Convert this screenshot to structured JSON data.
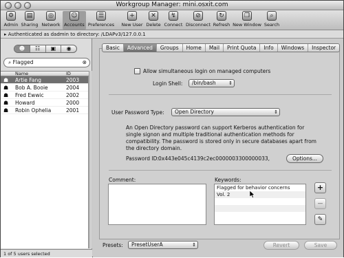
{
  "window": {
    "title": "Workgroup Manager: mini.osxit.com"
  },
  "toolbar": {
    "items": [
      {
        "label": "Admin",
        "icon": "admin-icon",
        "glyph": "⚙"
      },
      {
        "label": "Sharing",
        "icon": "sharing-icon",
        "glyph": "▤"
      },
      {
        "label": "Network",
        "icon": "network-icon",
        "glyph": "◎"
      },
      {
        "label": "Accounts",
        "icon": "accounts-icon",
        "glyph": "☺",
        "selected": true
      },
      {
        "label": "Preferences",
        "icon": "preferences-icon",
        "glyph": "☰"
      },
      {
        "label": "New User",
        "icon": "new-user-icon",
        "glyph": "+"
      },
      {
        "label": "Delete",
        "icon": "delete-icon",
        "glyph": "✕"
      },
      {
        "label": "Connect",
        "icon": "connect-icon",
        "glyph": "↯"
      },
      {
        "label": "Disconnect",
        "icon": "disconnect-icon",
        "glyph": "⊘"
      },
      {
        "label": "Refresh",
        "icon": "refresh-icon",
        "glyph": "↻"
      },
      {
        "label": "New Window",
        "icon": "new-window-icon",
        "glyph": "❐"
      },
      {
        "label": "Search",
        "icon": "search-icon",
        "glyph": "⌕"
      }
    ]
  },
  "auth": {
    "text": "Authenticated as dadmin to directory: /LDAPv3/127.0.0.1"
  },
  "sidebar": {
    "segments": [
      "user-icon",
      "group-icon",
      "computer-group-icon",
      "computer-list-icon"
    ],
    "search_value": "Flagged",
    "columns": {
      "name": "Name",
      "id": "ID"
    },
    "users": [
      {
        "name": "Artie Fang",
        "id": "2003",
        "selected": true
      },
      {
        "name": "Bob A. Booie",
        "id": "2004"
      },
      {
        "name": "Fred Ewwic",
        "id": "2002"
      },
      {
        "name": "Howard",
        "id": "2000"
      },
      {
        "name": "Robin Ophelia",
        "id": "2001"
      }
    ],
    "status": "1 of 5 users selected"
  },
  "tabs": [
    {
      "label": "Basic"
    },
    {
      "label": "Advanced",
      "selected": true
    },
    {
      "label": "Groups"
    },
    {
      "label": "Home"
    },
    {
      "label": "Mail"
    },
    {
      "label": "Print Quota"
    },
    {
      "label": "Info"
    },
    {
      "label": "Windows"
    },
    {
      "label": "Inspector"
    }
  ],
  "advanced": {
    "allow_login_label": "Allow simultaneous login on managed computers",
    "allow_login_checked": false,
    "login_shell_label": "Login Shell:",
    "login_shell_value": "/bin/bash",
    "password_type_label": "User Password Type:",
    "password_type_value": "Open Directory",
    "description": "An Open Directory password can support Kerberos authentication for single signon and multiple traditional authentication methods for compatibility. The password is stored only in secure databases apart from the directory domain.",
    "password_id_label": "Password ID:",
    "password_id_value": "0x443e045c4139c2ec0000003300000033,",
    "options_button": "Options...",
    "comment_label": "Comment:",
    "comment_value": "",
    "keywords_label": "Keywords:",
    "keywords": [
      "Flagged for behavior concerns",
      "Vol. 2"
    ]
  },
  "footer": {
    "presets_label": "Presets:",
    "presets_value": "PresetUserA",
    "revert_button": "Revert",
    "save_button": "Save"
  }
}
